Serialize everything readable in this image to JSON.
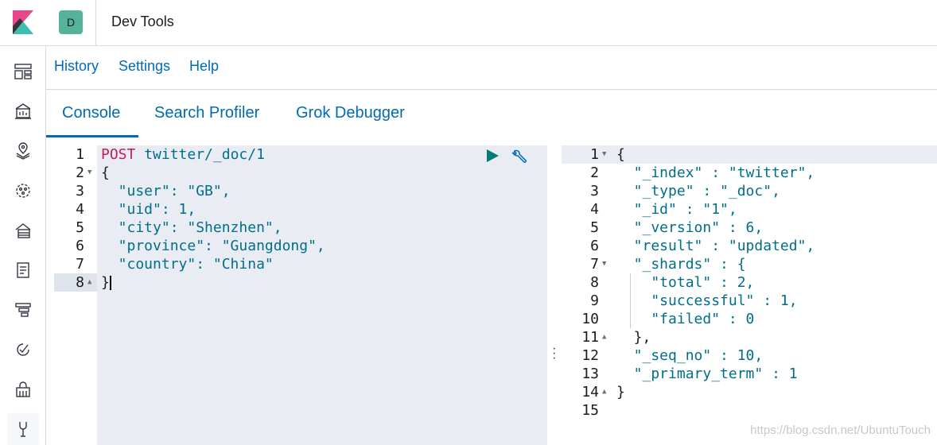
{
  "header": {
    "space_initial": "D",
    "app_title": "Dev Tools"
  },
  "topmenu": [
    "History",
    "Settings",
    "Help"
  ],
  "tabs": [
    "Console",
    "Search Profiler",
    "Grok Debugger"
  ],
  "active_tab": "Console",
  "request": {
    "method": "POST",
    "path": "twitter/_doc/1",
    "lines": [
      {
        "n": "1",
        "text": ""
      },
      {
        "n": "2",
        "text": "{"
      },
      {
        "n": "3",
        "text": "  \"user\": \"GB\","
      },
      {
        "n": "4",
        "text": "  \"uid\": 1,"
      },
      {
        "n": "5",
        "text": "  \"city\": \"Shenzhen\","
      },
      {
        "n": "6",
        "text": "  \"province\": \"Guangdong\","
      },
      {
        "n": "7",
        "text": "  \"country\": \"China\""
      },
      {
        "n": "8",
        "text": "}"
      }
    ]
  },
  "response": {
    "lines": [
      {
        "n": "1",
        "text": "{"
      },
      {
        "n": "2",
        "text": "  \"_index\" : \"twitter\","
      },
      {
        "n": "3",
        "text": "  \"_type\" : \"_doc\","
      },
      {
        "n": "4",
        "text": "  \"_id\" : \"1\","
      },
      {
        "n": "5",
        "text": "  \"_version\" : 6,"
      },
      {
        "n": "6",
        "text": "  \"result\" : \"updated\","
      },
      {
        "n": "7",
        "text": "  \"_shards\" : {"
      },
      {
        "n": "8",
        "text": "    \"total\" : 2,"
      },
      {
        "n": "9",
        "text": "    \"successful\" : 1,"
      },
      {
        "n": "10",
        "text": "    \"failed\" : 0"
      },
      {
        "n": "11",
        "text": "  },"
      },
      {
        "n": "12",
        "text": "  \"_seq_no\" : 10,"
      },
      {
        "n": "13",
        "text": "  \"_primary_term\" : 1"
      },
      {
        "n": "14",
        "text": "}"
      },
      {
        "n": "15",
        "text": ""
      }
    ]
  },
  "watermark": "https://blog.csdn.net/UbuntuTouch",
  "icons": [
    "kibana-logo",
    "dashboard-icon",
    "canvas-icon",
    "maps-icon",
    "ml-icon",
    "infrastructure-icon",
    "logs-icon",
    "apm-icon",
    "uptime-icon",
    "siem-icon",
    "dev-tools-icon"
  ],
  "colors": {
    "link": "#006bb4",
    "method": "#c41e52",
    "token": "#006e8a",
    "avatar": "#54b399",
    "play": "#017d73"
  }
}
